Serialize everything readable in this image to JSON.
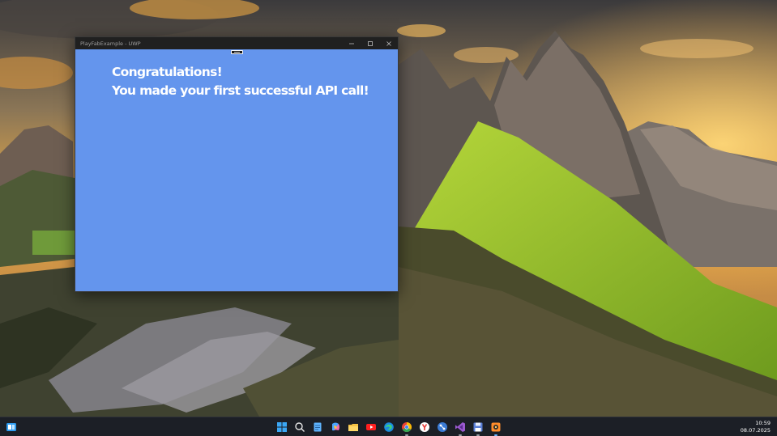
{
  "window": {
    "title": "PlayFabExample - UWP",
    "background_color": "#6495ed",
    "headline_line1": "Congratulations!",
    "headline_line2": "You made your first successful API call!"
  },
  "taskbar": {
    "pinned_icons": [
      "widgets-icon",
      "start-icon",
      "search-icon",
      "notepad-icon",
      "copilot-icon",
      "file-explorer-icon",
      "youtube-icon",
      "edge-icon",
      "chrome-icon",
      "yandex-browser-icon",
      "git-extensions-icon",
      "visual-studio-icon",
      "floppy-save-icon",
      "game-app-icon"
    ],
    "time": "10:59",
    "date": "08.07.2025"
  }
}
